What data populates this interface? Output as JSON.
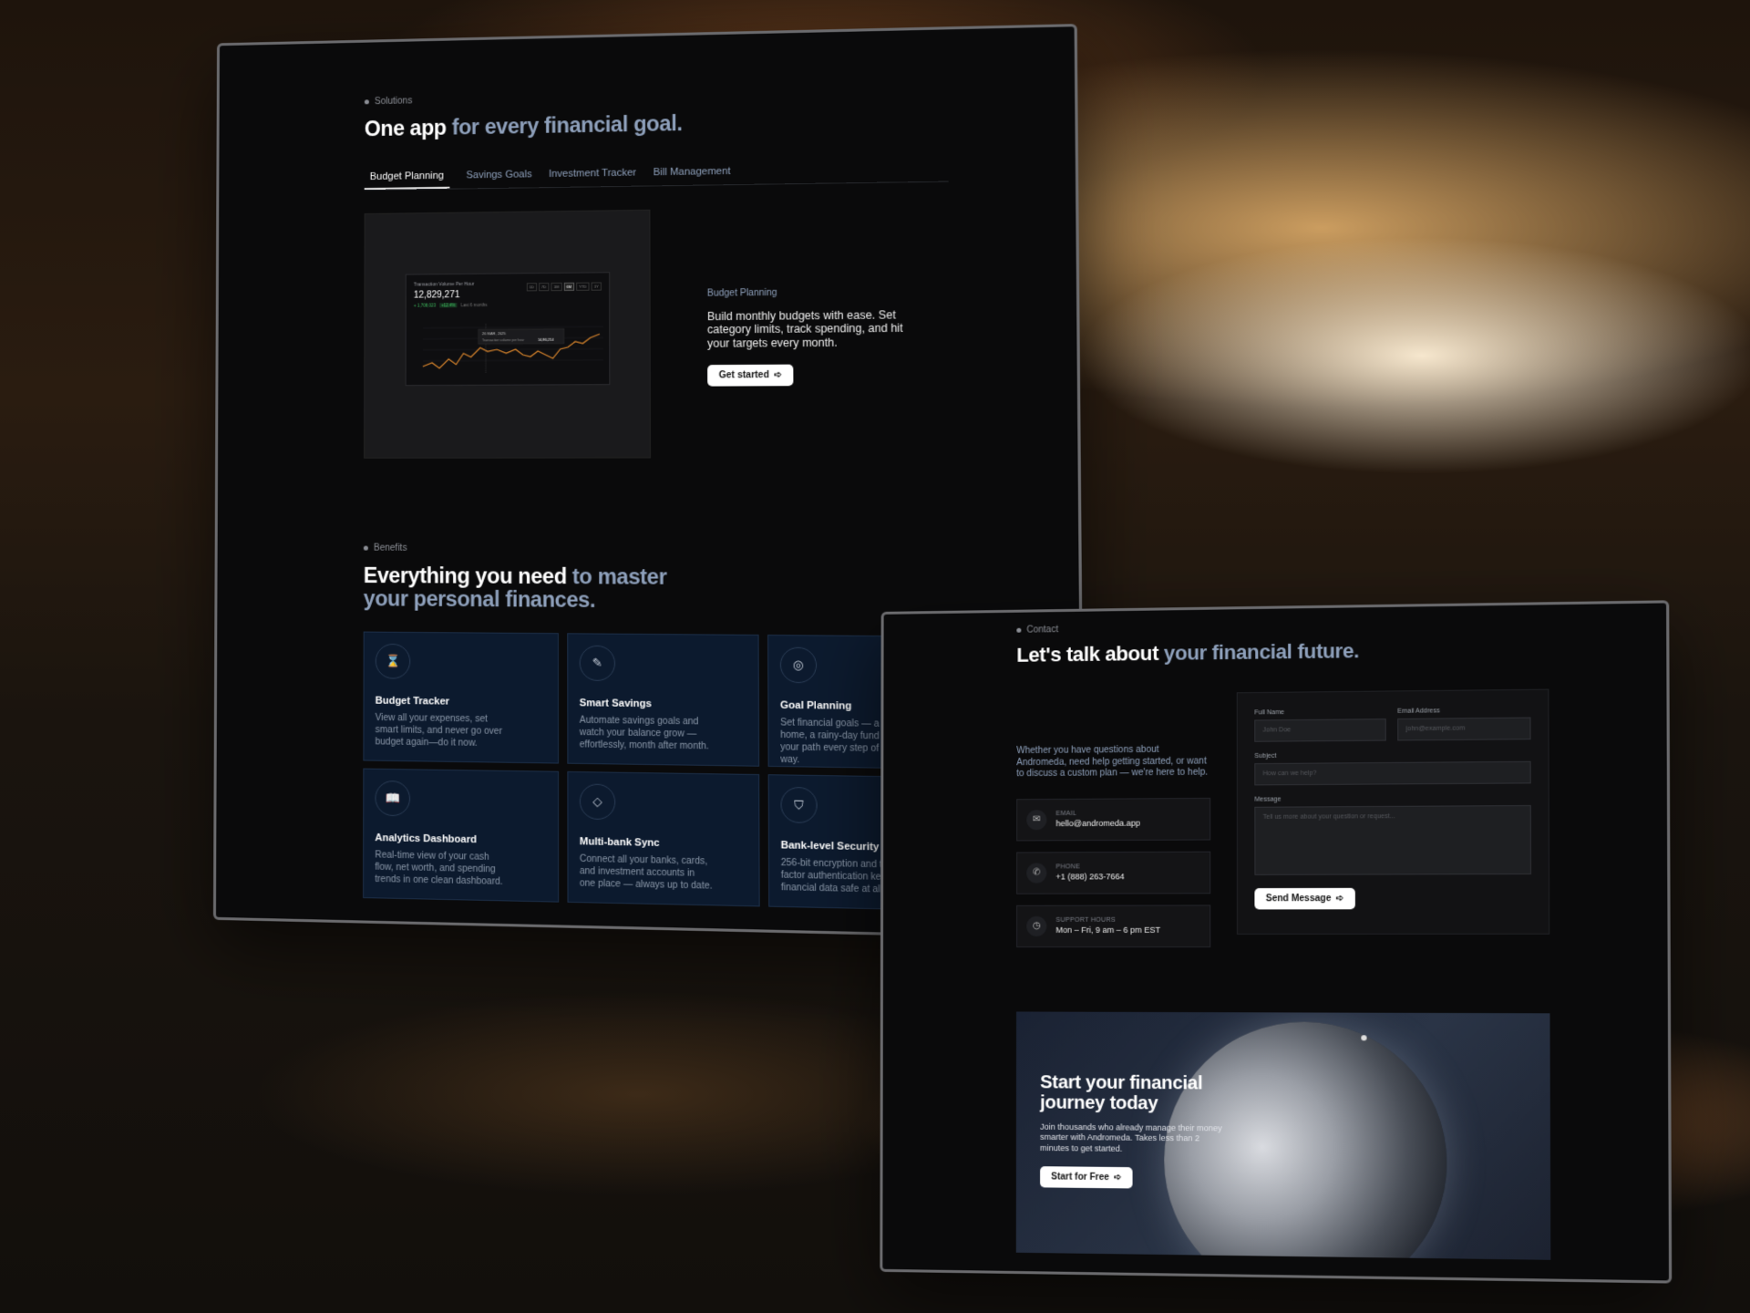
{
  "solutions": {
    "eyebrow": "Solutions",
    "title_main": "One app",
    "title_mute": " for every financial goal.",
    "tabs": [
      "Budget Planning",
      "Savings Goals",
      "Investment Tracker",
      "Bill Management"
    ],
    "preview": {
      "card_title": "Transaction Volume Per Hour",
      "big_number": "12,829,271",
      "delta": "+ 1,708,023",
      "pill": "+12.4%",
      "compare": "Last 6 months",
      "ranges": [
        "1D",
        "7D",
        "1M",
        "6M",
        "YTD",
        "1Y"
      ],
      "tooltip_date": "26 MAR, 2025",
      "tooltip_label": "Transaction volume per hour",
      "tooltip_value": "14,86,214"
    },
    "panel_label": "Budget Planning",
    "panel_text": "Build monthly budgets with ease. Set category limits, track spending, and hit your targets every month.",
    "cta": "Get started"
  },
  "benefits": {
    "eyebrow": "Benefits",
    "title_main": "Everything you need",
    "title_mute": " to master your personal finances.",
    "cards": [
      {
        "title": "Budget Tracker",
        "desc": "View all your expenses, set smart limits, and never go over budget again—do it now.",
        "icon": "hourglass-icon"
      },
      {
        "title": "Smart Savings",
        "desc": "Automate savings goals and watch your balance grow — effortlessly, month after month.",
        "icon": "feather-icon"
      },
      {
        "title": "Goal Planning",
        "desc": "Set financial goals — a trip, a home, a rainy-day fund — and your path every step of the way.",
        "icon": "target-icon"
      },
      {
        "title": "Analytics Dashboard",
        "desc": "Real-time view of your cash flow, net worth, and spending trends in one clean dashboard.",
        "icon": "book-icon"
      },
      {
        "title": "Multi-bank Sync",
        "desc": "Connect all your banks, cards, and investment accounts in one place — always up to date.",
        "icon": "gem-icon"
      },
      {
        "title": "Bank-level Security",
        "desc": "256-bit encryption and two-factor authentication keep your financial data safe at all times.",
        "icon": "shield-icon"
      }
    ]
  },
  "contact": {
    "eyebrow": "Contact",
    "title_main": "Let's talk about",
    "title_mute": " your financial future.",
    "intro": "Whether you have questions about Andromeda, need help getting started, or want to discuss a custom plan — we're here to help.",
    "items": [
      {
        "label": "EMAIL",
        "value": "hello@andromeda.app",
        "icon": "mail-icon"
      },
      {
        "label": "PHONE",
        "value": "+1 (888) 263-7664",
        "icon": "phone-icon"
      },
      {
        "label": "SUPPORT HOURS",
        "value": "Mon – Fri, 9 am – 6 pm EST",
        "icon": "clock-icon"
      }
    ],
    "form": {
      "name_label": "Full Name",
      "name_placeholder": "John Doe",
      "email_label": "Email Address",
      "email_placeholder": "john@example.com",
      "subject_label": "Subject",
      "subject_placeholder": "How can we help?",
      "message_label": "Message",
      "message_placeholder": "Tell us more about your question or request...",
      "submit": "Send Message"
    }
  },
  "cta_banner": {
    "title": "Start your financial journey today",
    "text": "Join thousands who already manage their money smarter with Andromeda. Takes less than 2 minutes to get started.",
    "button": "Start for Free"
  },
  "colors": {
    "accent_mute": "#8ea0bb",
    "card_bg": "#0c1a2e",
    "chart_line": "#d9852c",
    "positive": "#3fbf5f"
  }
}
